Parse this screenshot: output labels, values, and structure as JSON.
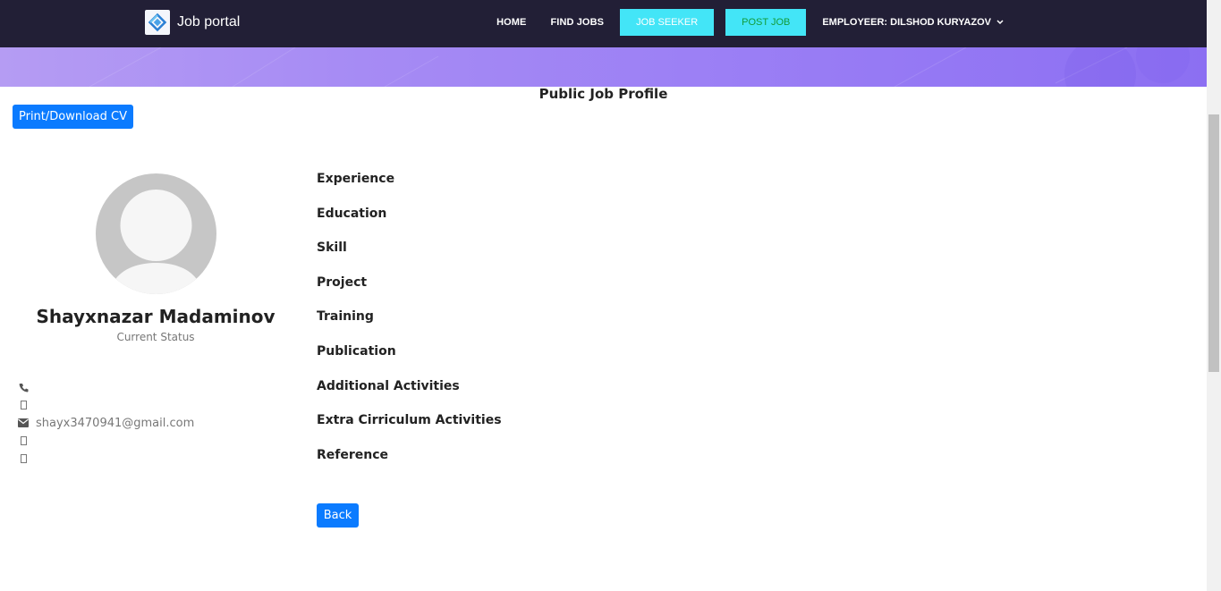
{
  "header": {
    "brand_title": "Job portal",
    "logo_icon": "job-portal-logo-icon",
    "nav": {
      "home": "HOME",
      "find_jobs": "FIND JOBS",
      "job_seeker": "JOB SEEKER",
      "post_job": "POST JOB",
      "user_menu": "EMPLOYEER: DILSHOD KURYAZOV"
    }
  },
  "page": {
    "title": "Public Job Profile",
    "print_button": "Print/Download CV",
    "back_button": "Back"
  },
  "profile": {
    "name": "Shayxnazar Madaminov",
    "status": "Current Status",
    "email": "shayx3470941@gmail.com",
    "contacts": [
      {
        "icon": "phone-icon",
        "value": ""
      },
      {
        "icon": "missing-glyph-icon",
        "value": ""
      },
      {
        "icon": "envelope-icon",
        "value": "shayx3470941@gmail.com"
      },
      {
        "icon": "missing-glyph-icon",
        "value": ""
      },
      {
        "icon": "missing-glyph-icon",
        "value": ""
      }
    ]
  },
  "sections": [
    "Experience",
    "Education",
    "Skill",
    "Project",
    "Training",
    "Publication",
    "Additional Activities",
    "Extra Cirriculum Activities",
    "Reference"
  ],
  "colors": {
    "navbar_bg": "#221f36",
    "accent_cyan": "#43e5f7",
    "primary_blue": "#0b7bff",
    "banner_purple": "#9b7ff5"
  }
}
